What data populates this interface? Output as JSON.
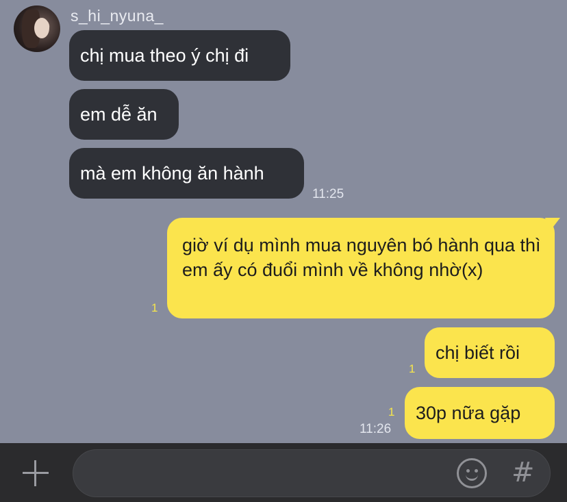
{
  "contact": {
    "name": "s_hi_nyuna_"
  },
  "messages": {
    "incoming": [
      {
        "text": "chị mua theo ý chị đi"
      },
      {
        "text": "em dễ ăn"
      },
      {
        "text": "mà em không ăn hành"
      }
    ],
    "incoming_time": "11:25",
    "outgoing": [
      {
        "text": "giờ ví dụ mình mua nguyên bó hành qua thì em ấy có đuổi mình về không nhờ(x)",
        "read": "1"
      },
      {
        "text": "chị biết rồi",
        "read": "1"
      },
      {
        "text": "30p nữa gặp",
        "read": "1"
      }
    ],
    "outgoing_time": "11:26"
  },
  "composer": {
    "placeholder": "",
    "icons": [
      "plus-icon",
      "emoji-icon",
      "hash-icon"
    ],
    "hash_glyph": "#"
  },
  "colors": {
    "background": "#878c9d",
    "incoming_bubble": "#2f3137",
    "outgoing_bubble": "#fbe44d",
    "bottom_bar": "#2b2b2d"
  }
}
